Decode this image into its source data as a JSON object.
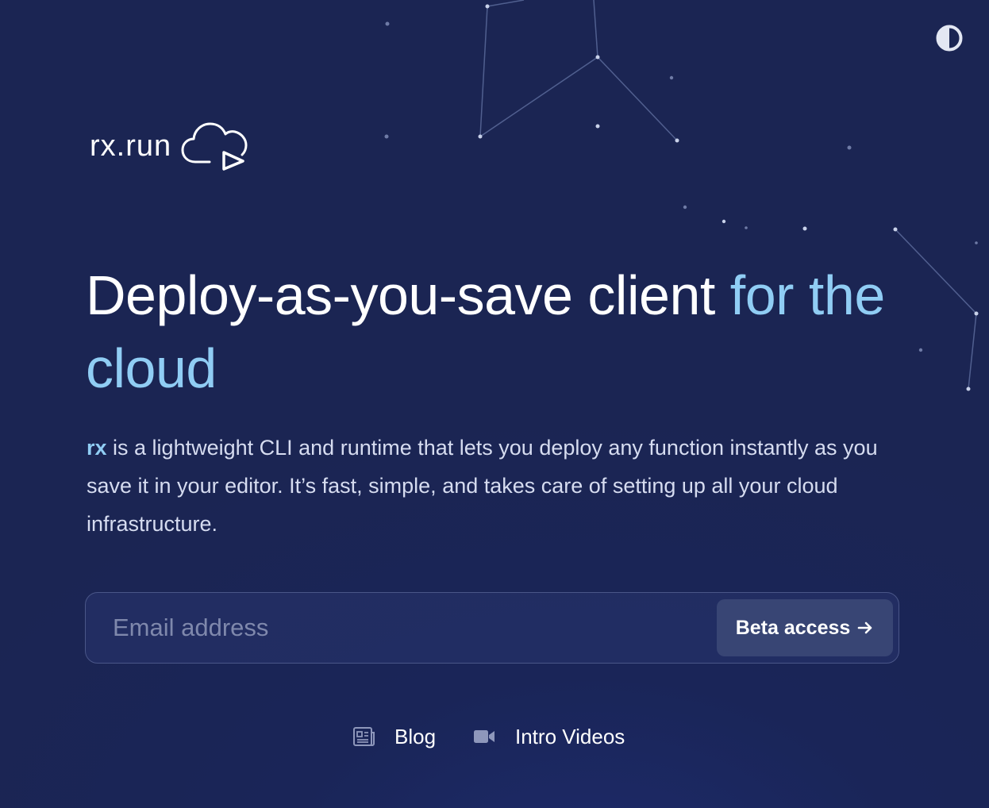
{
  "colors": {
    "background": "#1b2553",
    "accent": "#90cdf4",
    "button_bg": "#384574",
    "placeholder": "#7f88ac",
    "star": "#c9d2ea"
  },
  "header": {
    "theme_toggle_icon": "half-circle-contrast-icon",
    "logo_text": "rx.run",
    "logo_icon": "cloud-play-icon"
  },
  "hero": {
    "headline_main": "Deploy-as-you-save client ",
    "headline_accent": "for the cloud",
    "description_brand": "rx",
    "description_text": " is a lightweight CLI and runtime that lets you deploy any function instantly as you save it in your editor. It’s fast, simple, and takes care of setting up all your cloud infrastructure."
  },
  "signup": {
    "email_placeholder": "Email address",
    "email_value": "",
    "button_label": "Beta access",
    "button_icon": "arrow-right-icon"
  },
  "footer": {
    "links": [
      {
        "label": "Blog",
        "icon": "newspaper-icon"
      },
      {
        "label": "Intro Videos",
        "icon": "video-camera-icon"
      }
    ]
  }
}
